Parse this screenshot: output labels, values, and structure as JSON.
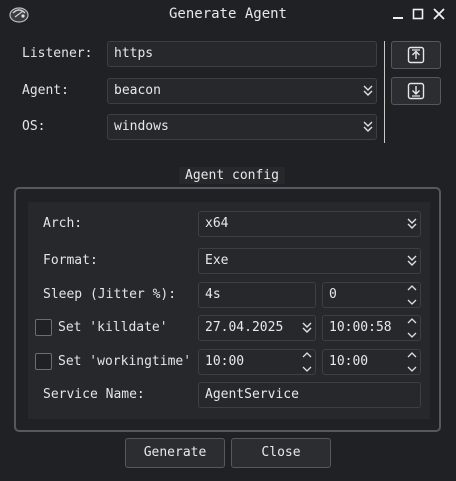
{
  "window": {
    "title": "Generate Agent",
    "controls": [
      "minimize-icon",
      "maximize-icon",
      "close-icon"
    ]
  },
  "form": {
    "listener": {
      "label": "Listener:",
      "value": "https"
    },
    "agent": {
      "label": "Agent:",
      "value": "beacon"
    },
    "os": {
      "label": "OS:",
      "value": "windows"
    }
  },
  "side_buttons": [
    "upload-icon",
    "download-icon"
  ],
  "agent_config": {
    "title": "Agent config",
    "arch": {
      "label": "Arch:",
      "value": "x64"
    },
    "format": {
      "label": "Format:",
      "value": "Exe"
    },
    "sleep": {
      "label": "Sleep (Jitter %):",
      "value": "4s",
      "jitter": "0"
    },
    "killdate": {
      "label": "Set 'killdate'",
      "checked": false,
      "date": "27.04.2025",
      "time": "10:00:58"
    },
    "workingtime": {
      "label": "Set 'workingtime'",
      "checked": false,
      "start": "10:00",
      "end": "10:00"
    },
    "service_name": {
      "label": "Service Name:",
      "value": "AgentService"
    }
  },
  "buttons": {
    "generate": "Generate",
    "close": "Close"
  }
}
